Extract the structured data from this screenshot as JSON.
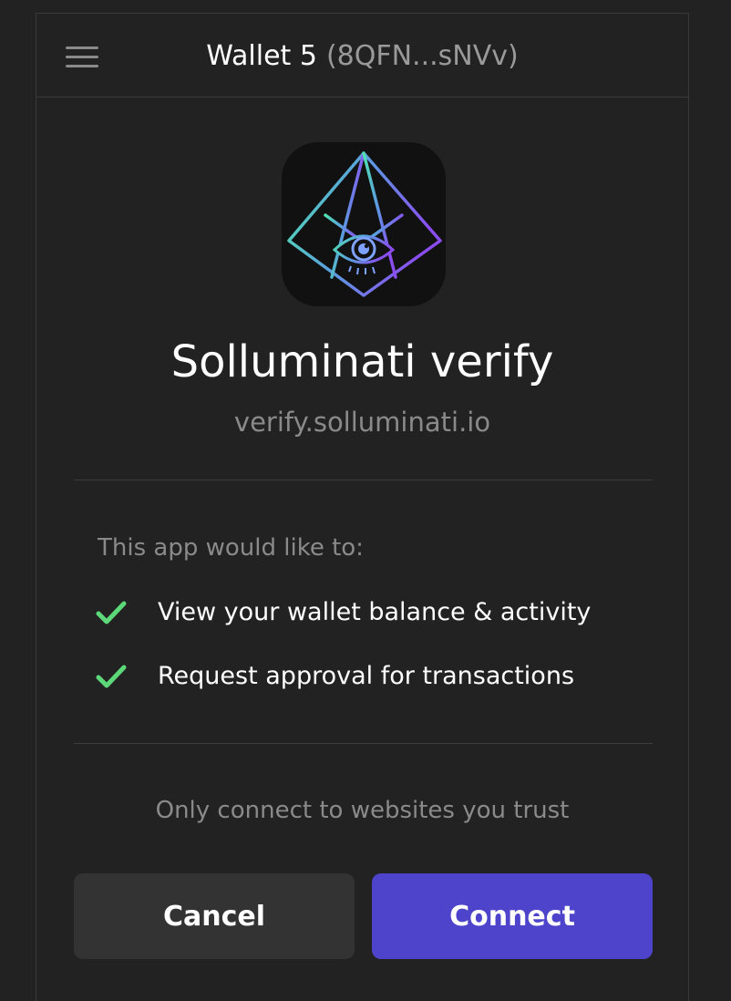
{
  "header": {
    "wallet_name": "Wallet 5",
    "wallet_address": "(8QFN...sNVv)",
    "menu_icon": "hamburger-menu-icon"
  },
  "app": {
    "icon": "solluminati-pyramid-eye-logo",
    "name": "Solluminati verify",
    "url": "verify.solluminati.io"
  },
  "permissions": {
    "heading": "This app would like to:",
    "items": [
      {
        "label": "View your wallet balance & activity",
        "icon": "check-icon"
      },
      {
        "label": "Request approval for transactions",
        "icon": "check-icon"
      }
    ]
  },
  "trust_note": "Only connect to websites you trust",
  "actions": {
    "cancel_label": "Cancel",
    "connect_label": "Connect"
  },
  "colors": {
    "background": "#222222",
    "accent": "#4d44cb",
    "check": "#5dd879",
    "muted_text": "#8a8a8a",
    "cancel_button": "#333333"
  }
}
